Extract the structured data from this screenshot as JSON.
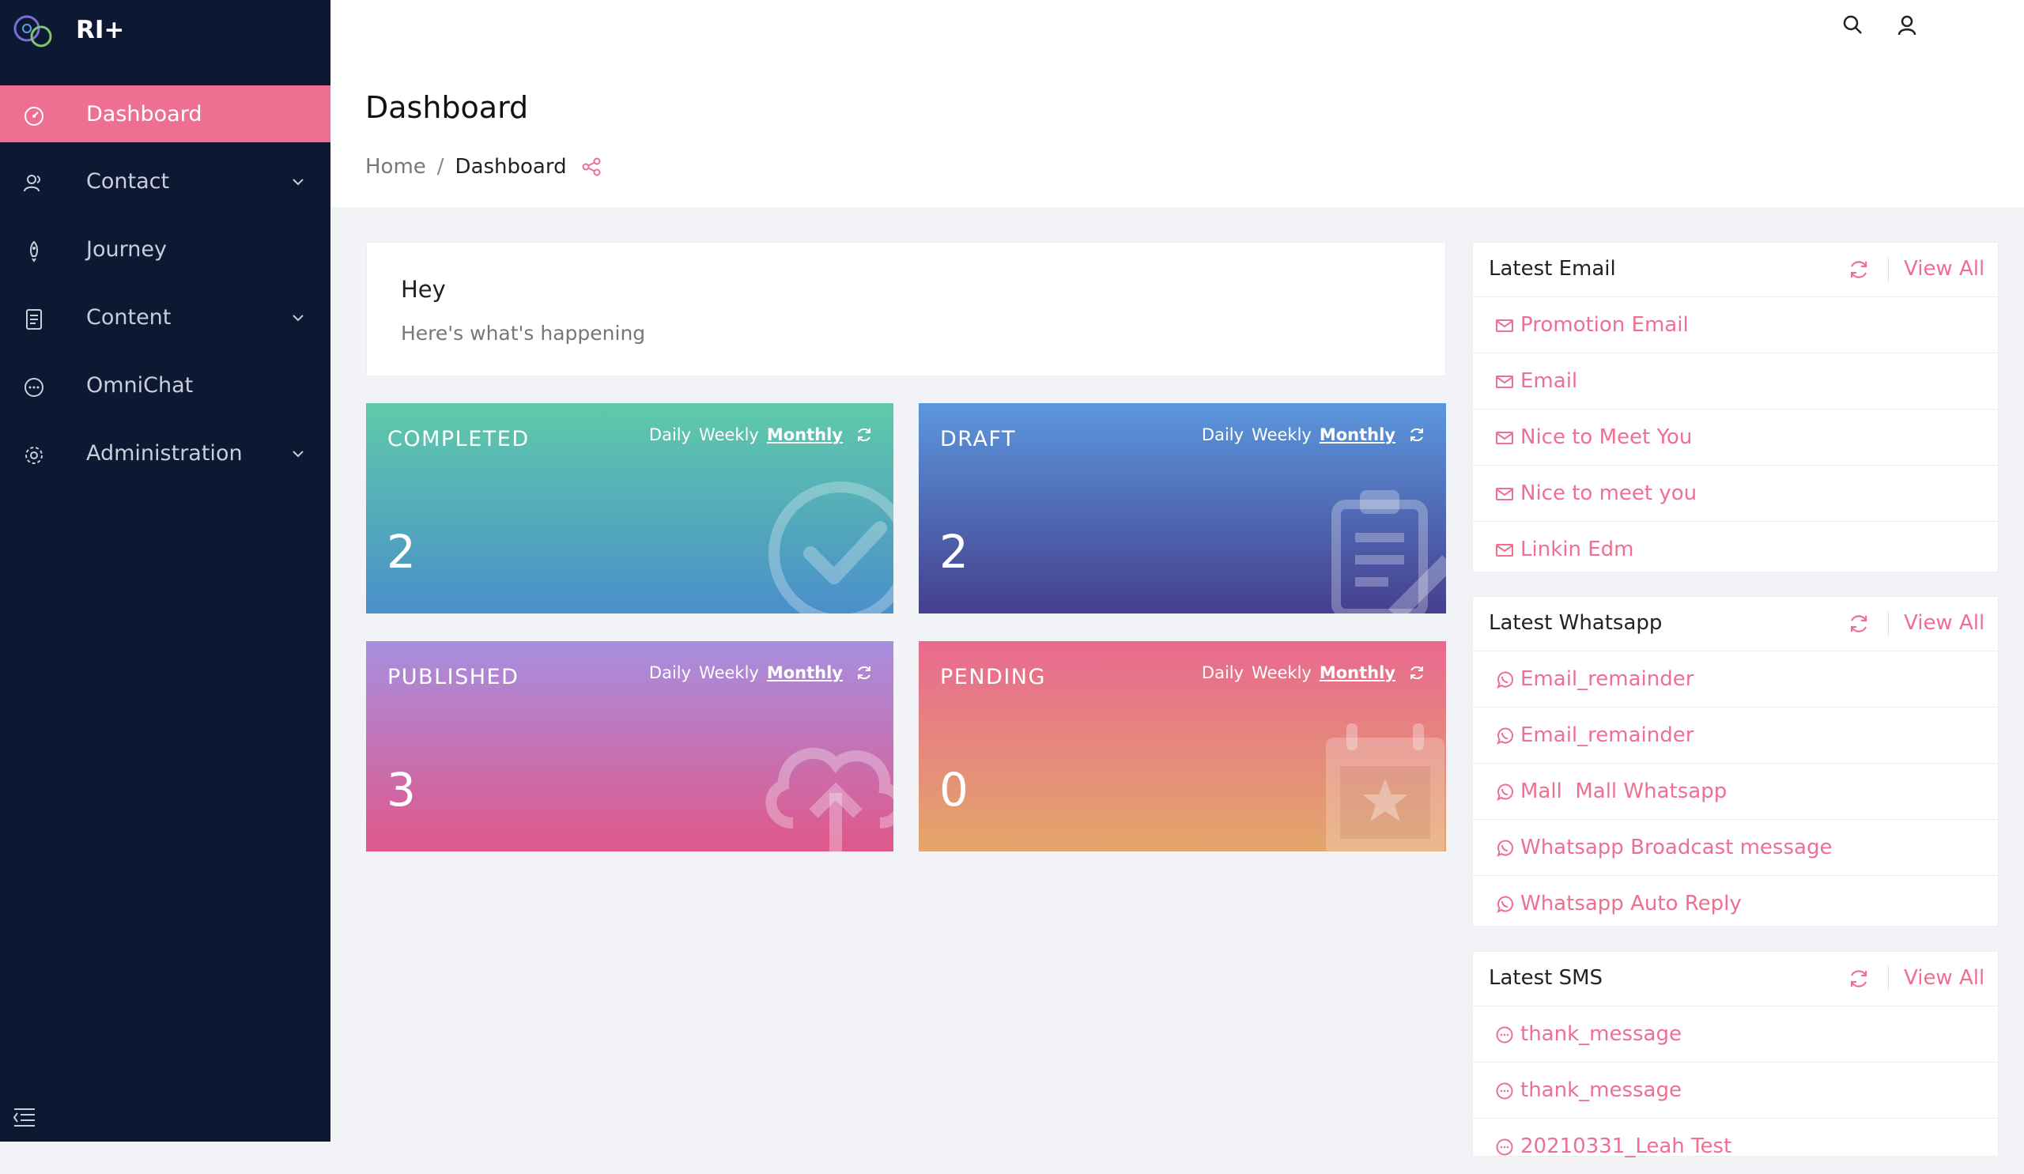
{
  "brand": {
    "name": "RI+",
    "logo_icon": "logo-circles-icon"
  },
  "sidebar": {
    "items": [
      {
        "label": "Dashboard",
        "icon": "dashboard-gauge-icon",
        "active": true,
        "has_submenu": false
      },
      {
        "label": "Contact",
        "icon": "users-icon",
        "active": false,
        "has_submenu": true
      },
      {
        "label": "Journey",
        "icon": "rocket-icon",
        "active": false,
        "has_submenu": false
      },
      {
        "label": "Content",
        "icon": "document-icon",
        "active": false,
        "has_submenu": true
      },
      {
        "label": "OmniChat",
        "icon": "chat-bubble-icon",
        "active": false,
        "has_submenu": false
      },
      {
        "label": "Administration",
        "icon": "gear-icon",
        "active": false,
        "has_submenu": true
      }
    ],
    "collapse_icon": "collapse-menu-icon"
  },
  "topbar": {
    "icons": [
      "search-icon",
      "user-icon"
    ]
  },
  "header": {
    "title": "Dashboard",
    "breadcrumb": {
      "home": "Home",
      "separator": "/",
      "current": "Dashboard"
    },
    "share_icon": "share-icon"
  },
  "welcome": {
    "title": "Hey",
    "subtitle": "Here's what's happening"
  },
  "stats": [
    {
      "title": "COMPLETED",
      "value": "2",
      "periods": [
        "Daily",
        "Weekly",
        "Monthly"
      ],
      "selected": "Monthly",
      "bg_icon": "check-circle-icon"
    },
    {
      "title": "DRAFT",
      "value": "2",
      "periods": [
        "Daily",
        "Weekly",
        "Monthly"
      ],
      "selected": "Monthly",
      "bg_icon": "clipboard-edit-icon"
    },
    {
      "title": "PUBLISHED",
      "value": "3",
      "periods": [
        "Daily",
        "Weekly",
        "Monthly"
      ],
      "selected": "Monthly",
      "bg_icon": "cloud-upload-icon"
    },
    {
      "title": "PENDING",
      "value": "0",
      "periods": [
        "Daily",
        "Weekly",
        "Monthly"
      ],
      "selected": "Monthly",
      "bg_icon": "calendar-star-icon"
    }
  ],
  "panels": {
    "email": {
      "title": "Latest Email",
      "view_all": "View All",
      "item_icon": "mail-icon",
      "items": [
        "Promotion Email",
        "Email",
        "Nice to Meet You",
        "Nice to meet you",
        "Linkin Edm"
      ]
    },
    "whatsapp": {
      "title": "Latest Whatsapp",
      "view_all": "View All",
      "item_icon": "whatsapp-icon",
      "items": [
        "Email_remainder",
        "Email_remainder",
        "Mall  Mall Whatsapp",
        "Whatsapp Broadcast message",
        "Whatsapp Auto Reply"
      ]
    },
    "sms": {
      "title": "Latest SMS",
      "view_all": "View All",
      "item_icon": "sms-bubble-icon",
      "items": [
        "thank_message",
        "thank_message",
        "20210331_Leah Test"
      ]
    }
  },
  "colors": {
    "accent": "#ef6f93",
    "sidebar_bg": "#0d1833",
    "page_bg": "#f2f3f7"
  }
}
